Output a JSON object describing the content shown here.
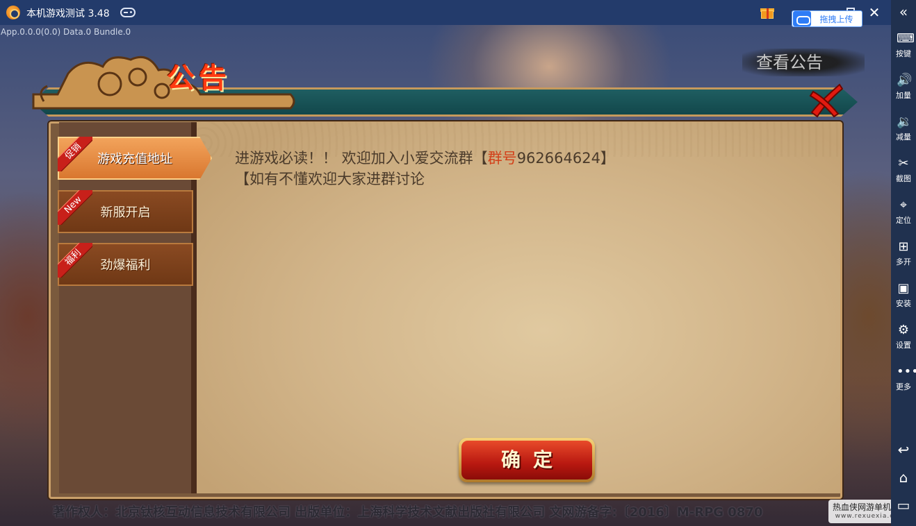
{
  "titlebar": {
    "title": "本机游戏测试 3.48",
    "upload_label": "拖拽上传"
  },
  "sidebar": {
    "items": [
      {
        "icon": "keyboard-icon",
        "label": "按键"
      },
      {
        "icon": "volume-up-icon",
        "label": "加量"
      },
      {
        "icon": "volume-down-icon",
        "label": "减量"
      },
      {
        "icon": "scissors-icon",
        "label": "截图"
      },
      {
        "icon": "location-pin-icon",
        "label": "定位"
      },
      {
        "icon": "multi-instance-icon",
        "label": "多开"
      },
      {
        "icon": "apk-install-icon",
        "label": "安装"
      },
      {
        "icon": "gear-icon",
        "label": "设置"
      },
      {
        "icon": "more-dots-icon",
        "label": "更多"
      }
    ]
  },
  "game": {
    "debug_info": "App.0.0.0(0.0) Data.0 Bundle.0",
    "view_notice_label": "查看公告",
    "copyright": "著作权人：北京钛核互动信息技术有限公司  出版单位：上海科学技术文献出版社有限公司 文网游备字:〔2016〕M-RPG 0870",
    "watermark_line1": "热血侠网游单机论坛",
    "watermark_line2": "www.rexuexia.com"
  },
  "dialog": {
    "title": "公告",
    "tabs": [
      {
        "badge": "促销",
        "label": "游戏充值地址",
        "active": true
      },
      {
        "badge": "New",
        "label": "新服开启",
        "active": false
      },
      {
        "badge": "福利",
        "label": "劲爆福利",
        "active": false
      }
    ],
    "content": {
      "line1_prefix": "进游戏必读！！ 欢迎加入小爱交流群【",
      "line1_highlight": "群号",
      "line1_suffix": "962664624】",
      "line2": "【如有不懂欢迎大家进群讨论"
    },
    "confirm_label": "确定"
  },
  "colors": {
    "title_red": "#ff3b12",
    "highlight": "#d2401a",
    "active_tab": "#d9772f",
    "sidebar_bg": "#20314f",
    "titlebar_bg": "#233b6b"
  }
}
